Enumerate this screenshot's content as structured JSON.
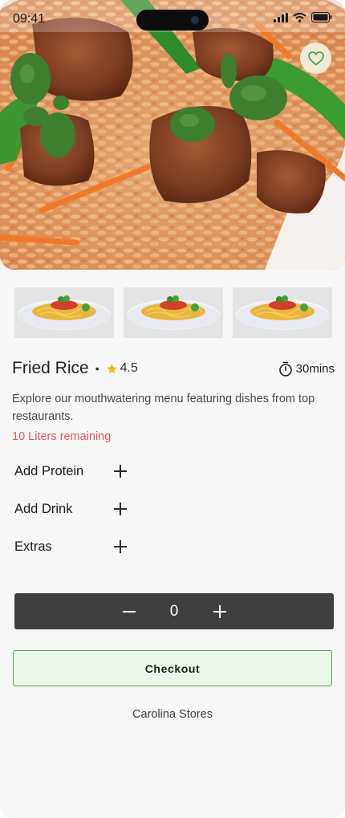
{
  "status_bar": {
    "time": "09:41"
  },
  "product": {
    "name": "Fried Rice",
    "separator": "•",
    "rating": "4.5",
    "prep_time": "30mins",
    "description": "Explore our mouthwatering menu featuring dishes from top restaurants.",
    "stock_note": "10 Liters remaining",
    "thumbnail_count": 3
  },
  "options": [
    {
      "label": "Add Protein"
    },
    {
      "label": "Add Drink"
    },
    {
      "label": "Extras"
    }
  ],
  "quantity": {
    "value": "0"
  },
  "actions": {
    "checkout_label": "Checkout"
  },
  "store": {
    "name": "Carolina Stores"
  },
  "colors": {
    "accent_green": "#4fac4a",
    "favorite_green": "#3f9a3a",
    "stock_red": "#e15454",
    "star_gold": "#f2b51c",
    "stepper_bg": "#3f3f3f",
    "checkout_bg": "#ecf5e9"
  },
  "icons": {
    "favorite": "heart-icon",
    "rating": "star-icon",
    "prep_time": "timer-icon",
    "option_add": "plus-icon",
    "decrease": "minus-icon",
    "increase": "plus-icon"
  }
}
